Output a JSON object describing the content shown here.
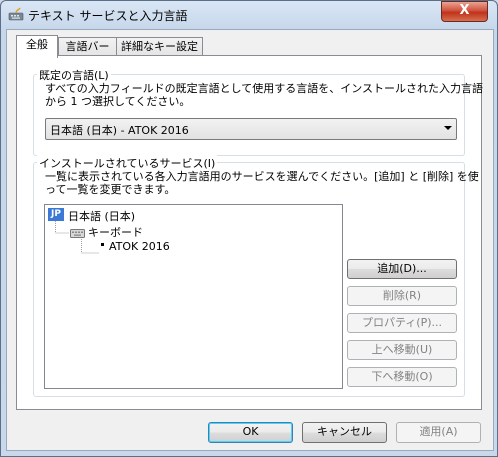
{
  "window": {
    "title": "テキスト サービスと入力言語",
    "close_glyph": "X"
  },
  "tabs": [
    {
      "label": "全般",
      "active": true
    },
    {
      "label": "言語バー",
      "active": false
    },
    {
      "label": "詳細なキー設定",
      "active": false
    }
  ],
  "default_language": {
    "group_label": "既定の言語(L)",
    "description_line1": "すべての入力フィールドの既定言語として使用する言語を、インストールされた入力言語",
    "description_line2": "から 1 つ選択してください。",
    "selected": "日本語 (日本) - ATOK 2016"
  },
  "installed_services": {
    "group_label": "インストールされているサービス(I)",
    "description_line1": "一覧に表示されている各入力言語用のサービスを選んでください。[追加] と [削除] を使",
    "description_line2": "って一覧を変更できます。",
    "tree": {
      "language_badge": "JP",
      "language": "日本語 (日本)",
      "category": "キーボード",
      "service": "ATOK 2016"
    },
    "buttons": {
      "add": "追加(D)...",
      "remove": "削除(R)",
      "properties": "プロパティ(P)...",
      "move_up": "上へ移動(U)",
      "move_down": "下へ移動(O)"
    }
  },
  "footer": {
    "ok": "OK",
    "cancel": "キャンセル",
    "apply": "適用(A)"
  }
}
